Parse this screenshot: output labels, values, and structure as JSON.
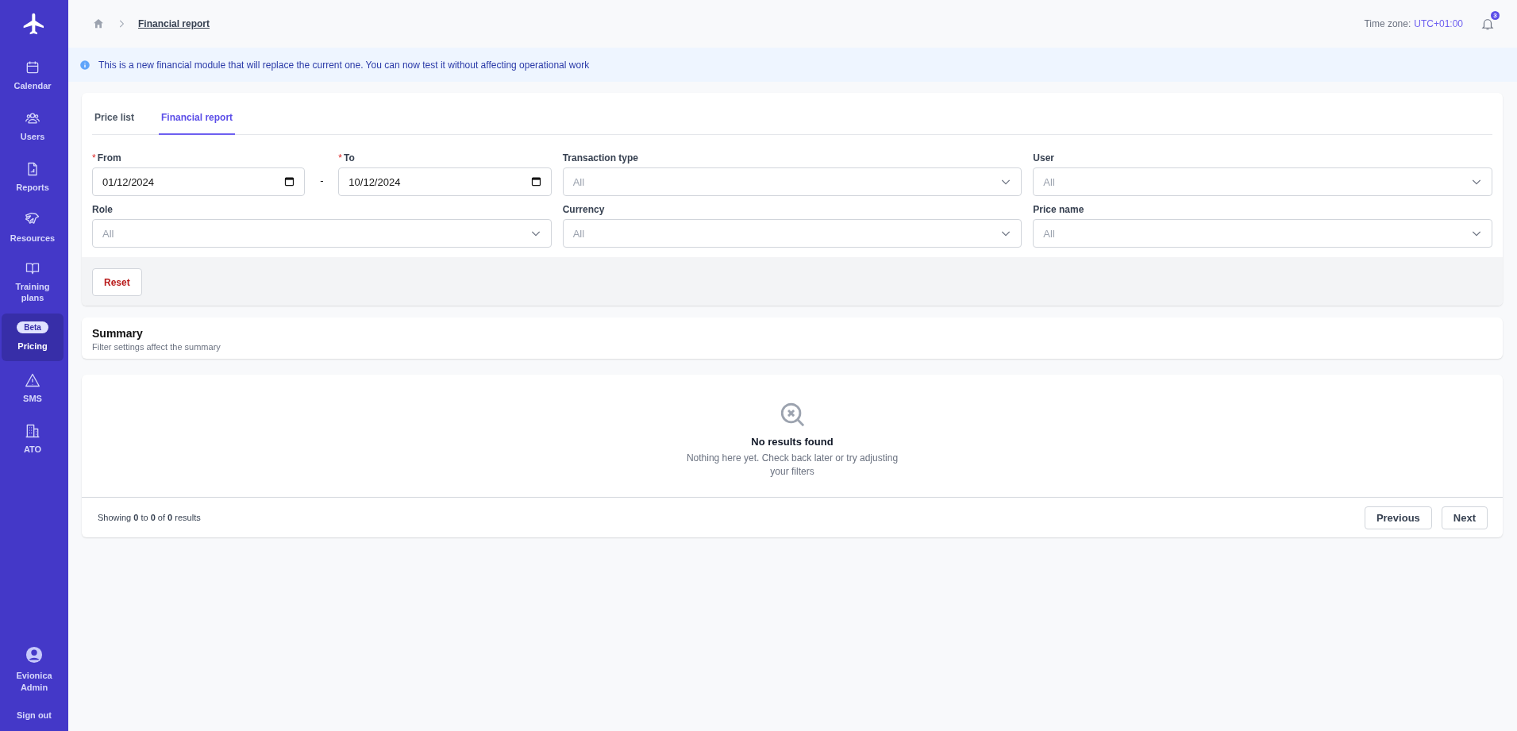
{
  "sidebar": {
    "items": [
      {
        "kind": "calendar",
        "label": "Calendar",
        "selected": false
      },
      {
        "kind": "users",
        "label": "Users",
        "selected": false
      },
      {
        "kind": "report",
        "label": "Reports",
        "selected": false
      },
      {
        "kind": "plane",
        "label": "Resources",
        "selected": false
      },
      {
        "kind": "book",
        "label": "Training plans",
        "selected": false
      },
      {
        "kind": "badge",
        "label": "Pricing",
        "badge": "Beta",
        "selected": true
      },
      {
        "kind": "warning",
        "label": "SMS",
        "selected": false
      },
      {
        "kind": "building",
        "label": "ATO",
        "selected": false
      }
    ],
    "user": {
      "name": "Evionica Admin"
    },
    "sign_out": "Sign out"
  },
  "breadcrumb": {
    "current": "Financial report"
  },
  "header": {
    "timezone_label": "Time zone:",
    "timezone_value": "UTC+01:00",
    "notification_count": "3"
  },
  "banner": {
    "text": "This is a new financial module that will replace the current one. You can now test it without affecting operational work"
  },
  "tabs": [
    {
      "label": "Price list",
      "selected": false
    },
    {
      "label": "Financial report",
      "selected": true
    }
  ],
  "filters": {
    "from": {
      "label": "From",
      "required_mark": "*",
      "value": "01/12/2024"
    },
    "separator": "-",
    "to": {
      "label": "To",
      "required_mark": "*",
      "value": "10/12/2024"
    },
    "selects": [
      {
        "label": "Transaction type",
        "placeholder": "All"
      },
      {
        "label": "User",
        "placeholder": "All"
      },
      {
        "label": "Role",
        "placeholder": "All"
      },
      {
        "label": "Currency",
        "placeholder": "All"
      },
      {
        "label": "Price name",
        "placeholder": "All"
      }
    ],
    "reset": "Reset"
  },
  "summary": {
    "title": "Summary",
    "subtitle": "Filter settings affect the summary"
  },
  "results": {
    "empty_title": "No results found",
    "empty_text": "Nothing here yet. Check back later or try adjusting your filters",
    "showing": "Showing **0** to **0** of **0** results",
    "previous": "Previous",
    "next": "Next"
  }
}
